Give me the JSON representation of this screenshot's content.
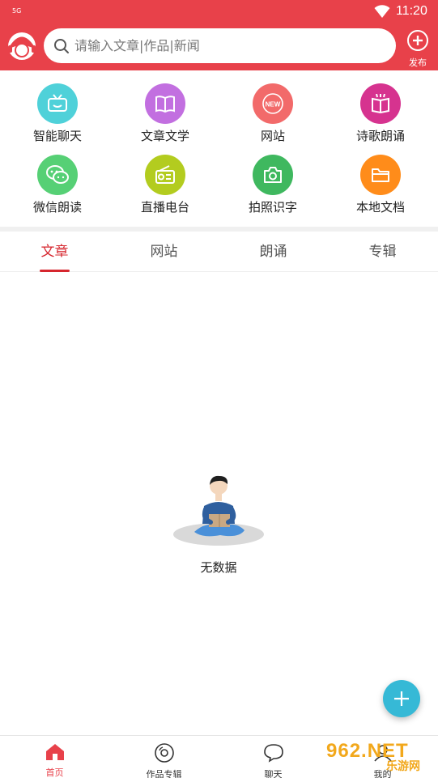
{
  "status_bar": {
    "signal": "5G",
    "time": "11:20",
    "wifi_icon": "wifi-icon"
  },
  "header": {
    "avatar_icon": "user-avatar-icon",
    "search": {
      "placeholder": "请输入文章|作品|新闻",
      "value": ""
    },
    "publish_label": "发布",
    "color": "#e8414a"
  },
  "grid": [
    {
      "label": "智能聊天",
      "icon": "tv-chat-icon",
      "color": "#4fd1d9"
    },
    {
      "label": "文章文学",
      "icon": "book-icon",
      "color": "#c26fe0"
    },
    {
      "label": "网站",
      "icon": "new-badge-icon",
      "color": "#f26a6a"
    },
    {
      "label": "诗歌朗诵",
      "icon": "poetry-book-icon",
      "color": "#d6338f"
    },
    {
      "label": "微信朗读",
      "icon": "wechat-icon",
      "color": "#56d075"
    },
    {
      "label": "直播电台",
      "icon": "radio-icon",
      "color": "#b3cc1f"
    },
    {
      "label": "拍照识字",
      "icon": "camera-icon",
      "color": "#3fb85f"
    },
    {
      "label": "本地文档",
      "icon": "folder-icon",
      "color": "#ff8c1a"
    }
  ],
  "tabs": [
    {
      "label": "文章",
      "active": true
    },
    {
      "label": "网站",
      "active": false
    },
    {
      "label": "朗诵",
      "active": false
    },
    {
      "label": "专辑",
      "active": false
    }
  ],
  "empty_state": {
    "label": "无数据"
  },
  "fab": {
    "icon": "plus-icon",
    "color": "#36b9d6"
  },
  "bottom_nav": [
    {
      "label": "首页",
      "icon": "home-icon",
      "active": true
    },
    {
      "label": "作品专辑",
      "icon": "disc-icon",
      "active": false
    },
    {
      "label": "聊天",
      "icon": "chat-bubble-icon",
      "active": false
    },
    {
      "label": "我的",
      "icon": "profile-icon",
      "active": false
    }
  ],
  "watermark": {
    "text": "962.NET",
    "subtext": "乐游网"
  }
}
